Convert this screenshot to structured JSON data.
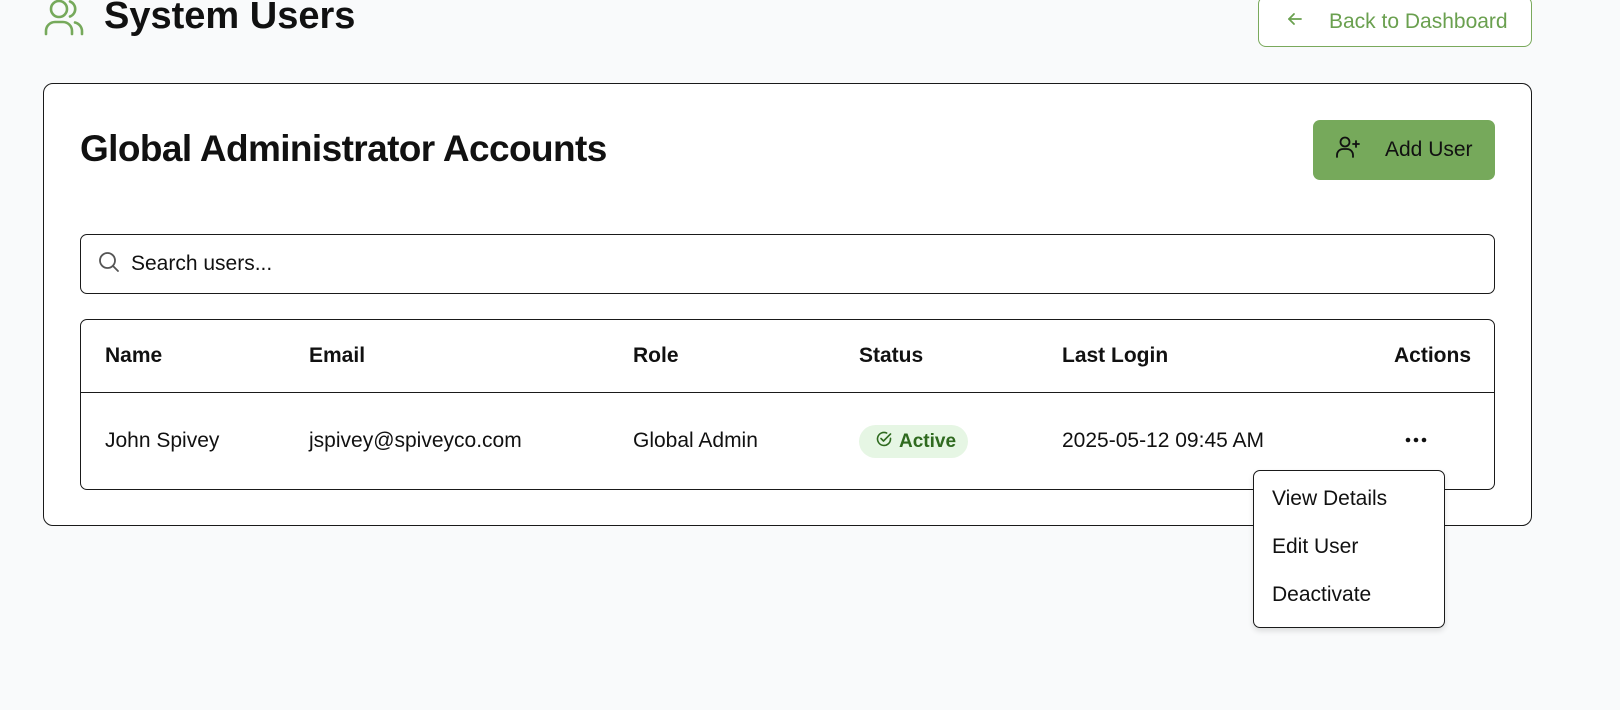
{
  "header": {
    "title": "System Users",
    "back_label": "Back to Dashboard"
  },
  "card": {
    "title": "Global Administrator Accounts",
    "add_label": "Add User"
  },
  "search": {
    "placeholder": "Search users..."
  },
  "table": {
    "columns": [
      "Name",
      "Email",
      "Role",
      "Status",
      "Last Login",
      "Actions"
    ],
    "rows": [
      {
        "name": "John Spivey",
        "email": "jspivey@spiveyco.com",
        "role": "Global Admin",
        "status": "Active",
        "last_login": "2025-05-12 09:45 AM"
      }
    ]
  },
  "menu": {
    "items": [
      "View Details",
      "Edit User",
      "Deactivate"
    ]
  },
  "colors": {
    "accent": "#76a95b",
    "accent_text": "#6aa04f",
    "status_bg": "#e6f6e4",
    "status_text": "#2f6a1f"
  },
  "icons": {
    "header": "users-icon",
    "back": "arrow-left-icon",
    "add": "user-plus-icon",
    "search": "search-icon",
    "status": "check-circle-icon",
    "actions": "more-horizontal-icon"
  }
}
